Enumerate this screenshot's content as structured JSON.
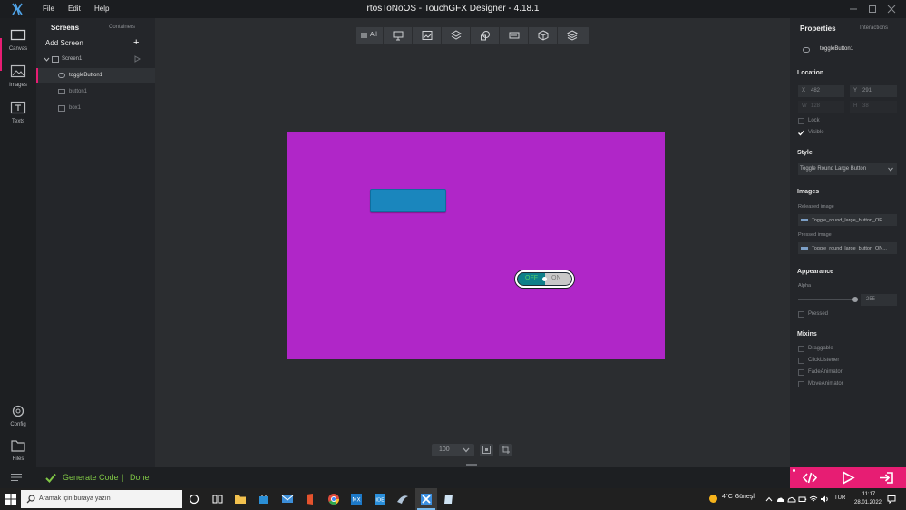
{
  "app": {
    "title": "rtosToNoOS - TouchGFX Designer - 4.18.1",
    "menu": [
      "File",
      "Edit",
      "Help"
    ]
  },
  "rail": {
    "items": [
      {
        "label": "Canvas",
        "icon": "canvas-icon"
      },
      {
        "label": "Images",
        "icon": "images-icon"
      },
      {
        "label": "Texts",
        "icon": "texts-icon"
      },
      {
        "label": "Config",
        "icon": "gear-icon"
      },
      {
        "label": "Files",
        "icon": "folder-icon"
      }
    ]
  },
  "tree": {
    "tab_screens": "Screens",
    "tab_containers": "Containers",
    "add_screen": "Add Screen",
    "add_icon": "+",
    "screen": "Screen1",
    "widgets": [
      "toggleButton1",
      "button1",
      "box1"
    ]
  },
  "toolbar": {
    "all_label": "All",
    "zoom": "100"
  },
  "canvas": {
    "screen_color": "#b026c8",
    "toggle_off": "OFF",
    "toggle_on": "ON"
  },
  "props": {
    "title": "Properties",
    "interactions": "Interactions",
    "widget_name": "toggleButton1",
    "location": "Location",
    "x_label": "X",
    "x_value": "482",
    "y_label": "Y",
    "y_value": "291",
    "w_label": "W",
    "w_value": "128",
    "h_label": "H",
    "h_value": "38",
    "lock": "Lock",
    "visible": "Visible",
    "style": "Style",
    "style_value": "Toggle Round Large Button",
    "images": "Images",
    "released_image_label": "Released image",
    "released_image": "Toggle_round_large_button_OF...",
    "pressed_image_label": "Pressed image",
    "pressed_image": "Toggle_round_large_button_ON...",
    "appearance": "Appearance",
    "alpha_label": "Alpha",
    "alpha_value": "255",
    "alpha_level": 1.0,
    "pressed": "Pressed",
    "mixins": "Mixins",
    "mixin_items": [
      "Draggable",
      "ClickListener",
      "FadeAnimator",
      "MoveAnimator"
    ]
  },
  "status": {
    "generate": "Generate Code",
    "separator": "|",
    "done": "Done"
  },
  "taskbar": {
    "search_placeholder": "Aramak için buraya yazın",
    "weather": "4°C  Güneşli",
    "lang": "TUR",
    "time": "11:17",
    "date": "28.01.2022"
  },
  "colors": {
    "accent": "#e71d73",
    "success": "#7fc645",
    "button": "#1a86bd"
  }
}
